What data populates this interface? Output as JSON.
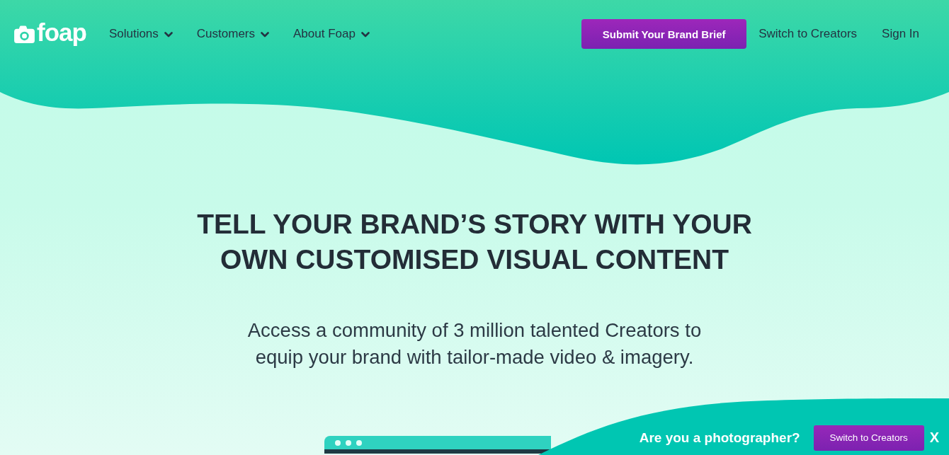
{
  "header": {
    "logo": {
      "text": "foap"
    },
    "nav": [
      {
        "label": "Solutions",
        "dropdown": true
      },
      {
        "label": "Customers",
        "dropdown": true
      },
      {
        "label": "About Foap",
        "dropdown": true
      }
    ],
    "cta": {
      "label": "Submit Your Brand Brief"
    },
    "links": [
      {
        "label": "Switch to Creators"
      },
      {
        "label": "Sign In"
      }
    ]
  },
  "hero": {
    "title": "TELL YOUR BRAND’S STORY WITH YOUR OWN CUSTOMISED VISUAL CONTENT",
    "subtitle": "Access a community of 3 million talented Creators to equip your brand with tailor-made video & imagery."
  },
  "banner": {
    "text": "Are you a photographer?",
    "button": "Switch to Creators",
    "close": "X"
  }
}
